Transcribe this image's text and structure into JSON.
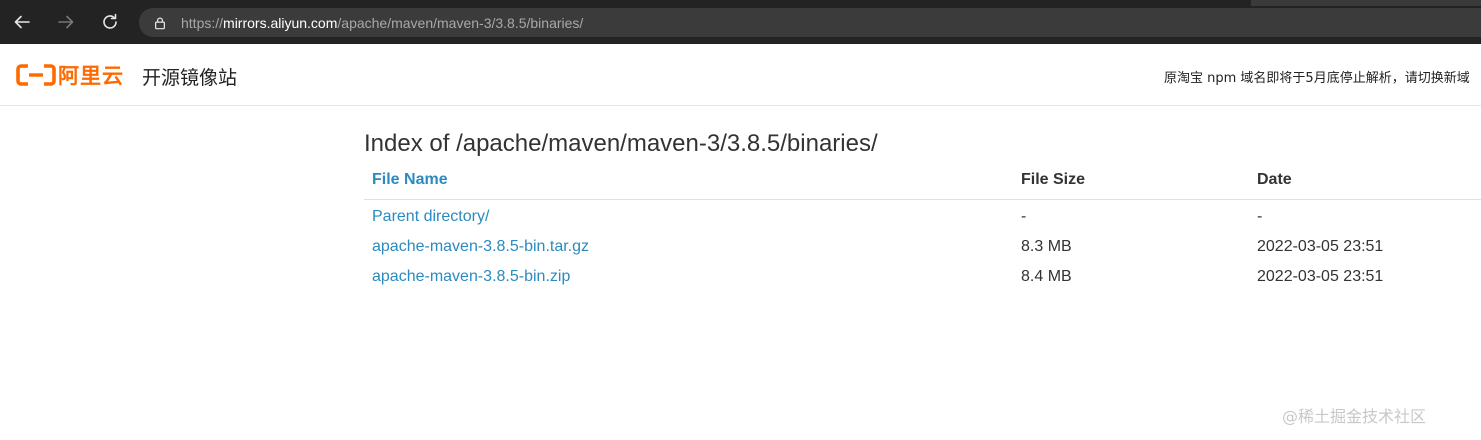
{
  "browser": {
    "url_scheme": "https://",
    "url_host": "mirrors.aliyun.com",
    "url_path": "/apache/maven/maven-3/3.8.5/binaries/"
  },
  "header": {
    "logo_text": "阿里云",
    "site_title": "开源镜像站",
    "notice": "原淘宝 npm 域名即将于5月底停止解析，请切换新域",
    "brand_color": "#ff6a00"
  },
  "main": {
    "title": "Index of /apache/maven/maven-3/3.8.5/binaries/",
    "columns": [
      "File Name",
      "File Size",
      "Date"
    ],
    "rows": [
      {
        "name": "Parent directory/",
        "size": "-",
        "date": "-"
      },
      {
        "name": "apache-maven-3.8.5-bin.tar.gz",
        "size": "8.3 MB",
        "date": "2022-03-05 23:51"
      },
      {
        "name": "apache-maven-3.8.5-bin.zip",
        "size": "8.4 MB",
        "date": "2022-03-05 23:51"
      }
    ],
    "link_color": "#2b8bc0"
  },
  "watermark": "@稀土掘金技术社区"
}
